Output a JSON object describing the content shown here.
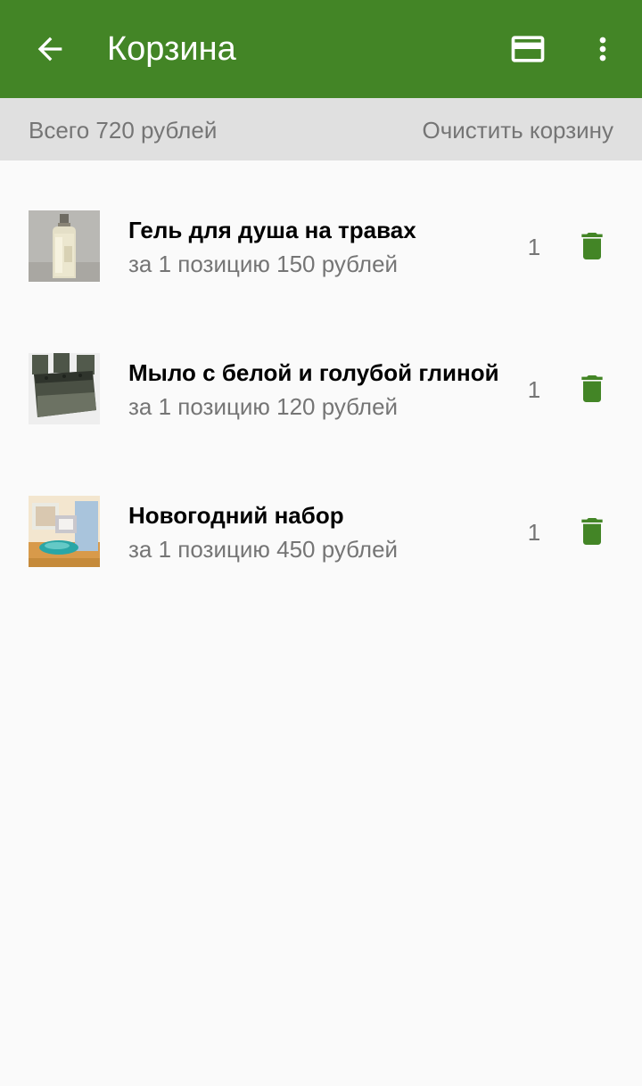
{
  "colors": {
    "app_bar": "#438526",
    "accent": "#438526",
    "summary_bar": "#e0e0e0",
    "background": "#fafafa",
    "secondary_text": "#757575"
  },
  "appbar": {
    "title": "Корзина",
    "back_icon": "arrow-back-icon",
    "card_icon": "credit-card-icon",
    "more_icon": "more-vert-icon"
  },
  "summary": {
    "total": "Всего 720 рублей",
    "clear": "Очистить корзину"
  },
  "cart": {
    "items": [
      {
        "name": "Гель для душа на травах",
        "price": "за 1 позицию 150 рублей",
        "qty": "1",
        "image": "shower-gel-bottle"
      },
      {
        "name": "Мыло с белой и голубой глиной",
        "price": "за 1 позицию 120 рублей",
        "qty": "1",
        "image": "clay-soap-bar"
      },
      {
        "name": "Новогодний набор",
        "price": "за 1 позицию 450 рублей",
        "qty": "1",
        "image": "gift-set-basket"
      }
    ],
    "delete_icon": "trash-icon"
  }
}
